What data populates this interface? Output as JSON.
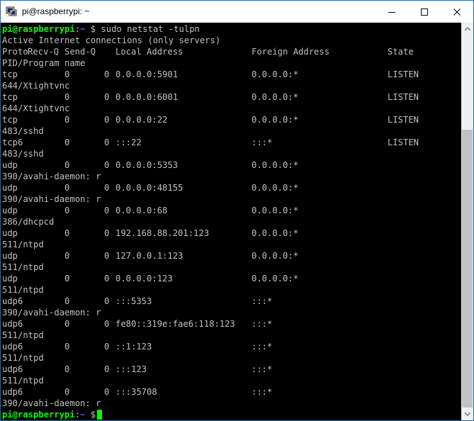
{
  "window": {
    "title": "pi@raspberrypi: ~"
  },
  "prompt": {
    "user_host": "pi@raspberrypi",
    "separator": ":",
    "path": "~",
    "symbol": "$"
  },
  "command": "sudo netstat -tulpn",
  "output": {
    "header_line": "Active Internet connections (only servers)",
    "columns": [
      "Proto",
      "Recv-Q",
      "Send-Q",
      "Local Address",
      "Foreign Address",
      "State"
    ],
    "columns_line2": "PID/Program name",
    "rows": [
      {
        "proto": "tcp",
        "recvq": "0",
        "sendq": "0",
        "local": "0.0.0.0:5901",
        "foreign": "0.0.0.0:*",
        "state": "LISTEN",
        "program": "644/Xtightvnc"
      },
      {
        "proto": "tcp",
        "recvq": "0",
        "sendq": "0",
        "local": "0.0.0.0:6001",
        "foreign": "0.0.0.0:*",
        "state": "LISTEN",
        "program": "644/Xtightvnc"
      },
      {
        "proto": "tcp",
        "recvq": "0",
        "sendq": "0",
        "local": "0.0.0.0:22",
        "foreign": "0.0.0.0:*",
        "state": "LISTEN",
        "program": "483/sshd"
      },
      {
        "proto": "tcp6",
        "recvq": "0",
        "sendq": "0",
        "local": ":::22",
        "foreign": ":::*",
        "state": "LISTEN",
        "program": "483/sshd"
      },
      {
        "proto": "udp",
        "recvq": "0",
        "sendq": "0",
        "local": "0.0.0.0:5353",
        "foreign": "0.0.0.0:*",
        "state": "",
        "program": "390/avahi-daemon: r"
      },
      {
        "proto": "udp",
        "recvq": "0",
        "sendq": "0",
        "local": "0.0.0.0:48155",
        "foreign": "0.0.0.0:*",
        "state": "",
        "program": "390/avahi-daemon: r"
      },
      {
        "proto": "udp",
        "recvq": "0",
        "sendq": "0",
        "local": "0.0.0.0:68",
        "foreign": "0.0.0.0:*",
        "state": "",
        "program": "386/dhcpcd"
      },
      {
        "proto": "udp",
        "recvq": "0",
        "sendq": "0",
        "local": "192.168.88.201:123",
        "foreign": "0.0.0.0:*",
        "state": "",
        "program": "511/ntpd"
      },
      {
        "proto": "udp",
        "recvq": "0",
        "sendq": "0",
        "local": "127.0.0.1:123",
        "foreign": "0.0.0.0:*",
        "state": "",
        "program": "511/ntpd"
      },
      {
        "proto": "udp",
        "recvq": "0",
        "sendq": "0",
        "local": "0.0.0.0:123",
        "foreign": "0.0.0.0:*",
        "state": "",
        "program": "511/ntpd"
      },
      {
        "proto": "udp6",
        "recvq": "0",
        "sendq": "0",
        "local": ":::5353",
        "foreign": ":::*",
        "state": "",
        "program": "390/avahi-daemon: r"
      },
      {
        "proto": "udp6",
        "recvq": "0",
        "sendq": "0",
        "local": "fe80::319e:fae6:118:123",
        "foreign": ":::*",
        "state": "",
        "program": "511/ntpd"
      },
      {
        "proto": "udp6",
        "recvq": "0",
        "sendq": "0",
        "local": "::1:123",
        "foreign": ":::*",
        "state": "",
        "program": "511/ntpd"
      },
      {
        "proto": "udp6",
        "recvq": "0",
        "sendq": "0",
        "local": ":::123",
        "foreign": ":::*",
        "state": "",
        "program": "511/ntpd"
      },
      {
        "proto": "udp6",
        "recvq": "0",
        "sendq": "0",
        "local": ":::35708",
        "foreign": ":::*",
        "state": "",
        "program": "390/avahi-daemon: r"
      }
    ]
  },
  "colors": {
    "prompt_user": "#00ff00",
    "prompt_path": "#5c5cff",
    "text": "#c0c0c0",
    "background": "#000000",
    "cursor": "#00ff00"
  },
  "icons": {
    "app": "putty-terminal-icon",
    "minimize": "minimize-icon",
    "maximize": "maximize-icon",
    "close": "close-icon"
  }
}
